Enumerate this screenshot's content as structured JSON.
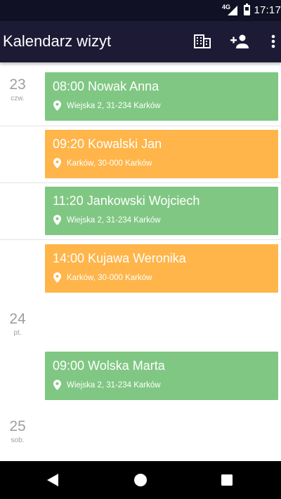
{
  "status_bar": {
    "network": "4G",
    "time": "17:17",
    "icons": [
      "signal-icon",
      "battery-icon"
    ]
  },
  "app_bar": {
    "title": "Kalendarz wizyt",
    "actions": [
      "office-building-icon",
      "add-person-icon",
      "more-vert-icon"
    ]
  },
  "days": [
    {
      "day": "23",
      "weekday": "czw."
    },
    {
      "day": "24",
      "weekday": "pt."
    },
    {
      "day": "25",
      "weekday": "sob."
    }
  ],
  "events": [
    {
      "title": "08:00 Nowak Anna",
      "location": "Wiejska 2, 31-234 Karków",
      "color": "#80c783"
    },
    {
      "title": "09:20 Kowalski Jan",
      "location": "Karków, 30-000 Karków",
      "color": "#ffb54a"
    },
    {
      "title": "11:20 Jankowski Wojciech",
      "location": "Wiejska 2, 31-234 Karków",
      "color": "#80c783"
    },
    {
      "title": "14:00 Kujawa Weronika",
      "location": "Karków, 30-000 Karków",
      "color": "#ffb54a"
    },
    {
      "title": "09:00 Wolska Marta",
      "location": "Wiejska 2, 31-234 Karków",
      "color": "#80c783"
    }
  ],
  "colors": {
    "status_bar": "#111125",
    "app_bar": "#1d1a36",
    "event_green": "#80c783",
    "event_orange": "#ffb54a",
    "day_label": "#9e9e9e"
  },
  "nav_bar": {
    "icons": [
      "back-icon",
      "home-icon",
      "recents-icon"
    ]
  }
}
